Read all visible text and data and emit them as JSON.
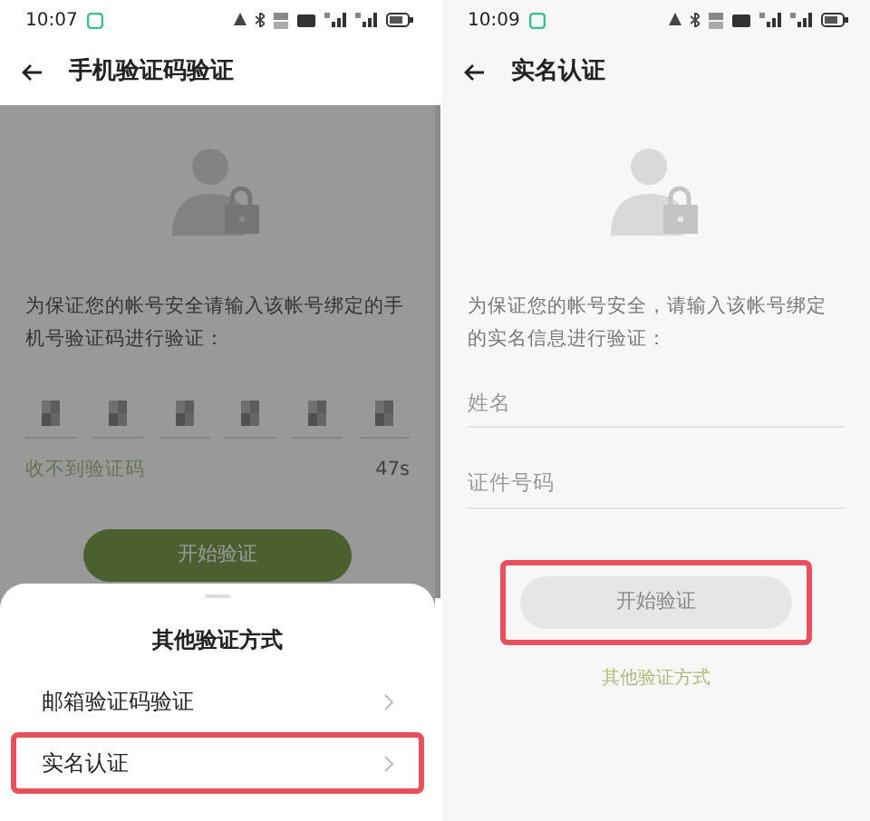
{
  "code_screen": {
    "status_time": "10:07",
    "title": "手机验证码验证",
    "dimmed": true,
    "instructions": "为保证您的帐号安全请输入该帐号绑定的手机号验证码进行验证：",
    "code_cells": [
      {
        "masked": true
      },
      {
        "masked": true
      },
      {
        "masked": true
      },
      {
        "masked": true
      },
      {
        "masked": true
      },
      {
        "masked": true
      }
    ],
    "resend_text": "收不到验证码",
    "countdown": "47s",
    "button": {
      "label": "开始验证"
    },
    "sheet": {
      "title": "其他验证方式",
      "options": [
        {
          "label": "邮箱验证码验证",
          "highlighted": false
        },
        {
          "label": "实名认证",
          "highlighted": true
        }
      ]
    }
  },
  "real_name_screen": {
    "status_time": "10:09",
    "title": "实名认证",
    "instructions": "为保证您的帐号安全，请输入该帐号绑定的实名信息进行验证：",
    "fields": [
      {
        "placeholder": "姓名"
      },
      {
        "placeholder": "证件号码"
      }
    ],
    "button": {
      "label": "开始验证",
      "highlighted": true
    },
    "link": "其他验证方式"
  }
}
